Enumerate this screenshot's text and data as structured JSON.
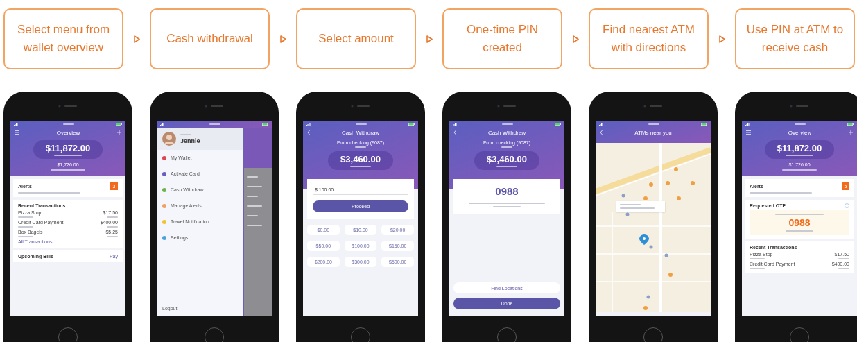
{
  "steps": [
    {
      "label": "Select menu from wallet overview",
      "screen": {
        "kind": "overview",
        "title": "Overview",
        "balance": "$11,872.00",
        "spent": "$1,726.00",
        "alerts": {
          "title": "Alerts",
          "count": "3"
        },
        "transactions": {
          "title": "Recent Transactions",
          "rows": [
            {
              "name": "Pizza Stop",
              "amount": "$17.50"
            },
            {
              "name": "Credit Card Payment",
              "amount": "$400.00"
            },
            {
              "name": "Box Bagels",
              "amount": "$5.25"
            }
          ],
          "link": "All Transactions"
        },
        "bills": {
          "title": "Upcoming Bills",
          "action": "Pay"
        }
      }
    },
    {
      "label": "Cash withdrawal",
      "screen": {
        "kind": "menu",
        "name": "Jennie",
        "items": [
          {
            "label": "My Wallet",
            "color": "#e0464e"
          },
          {
            "label": "Activate Card",
            "color": "#6a5cc0"
          },
          {
            "label": "Cash Withdraw",
            "color": "#6cb34a"
          },
          {
            "label": "Manage Alerts",
            "color": "#f0a060"
          },
          {
            "label": "Travel Notification",
            "color": "#f2c230"
          },
          {
            "label": "Settings",
            "color": "#4aa3df"
          }
        ],
        "logout": "Logout"
      }
    },
    {
      "label": "Select amount",
      "screen": {
        "kind": "withdraw",
        "title": "Cash Withdraw",
        "source": "From checking (9087)",
        "balance": "$3,460.00",
        "amount_value": "$ 100.00",
        "proceed": "Proceed",
        "amounts": [
          "$0.00",
          "$10.00",
          "$20.00",
          "$50.00",
          "$100.00",
          "$150.00",
          "$200.00",
          "$300.00",
          "$500.00"
        ]
      }
    },
    {
      "label": "One-time PIN created",
      "screen": {
        "kind": "pin",
        "title": "Cash Withdraw",
        "source": "From checking (9087)",
        "balance": "$3,460.00",
        "pin": "0988",
        "find": "Find Locations",
        "done": "Done"
      }
    },
    {
      "label": "Find nearest ATM with directions",
      "screen": {
        "kind": "map",
        "title": "ATMs near you"
      }
    },
    {
      "label": "Use PIN at ATM to receive cash",
      "screen": {
        "kind": "overview",
        "title": "Overview",
        "balance": "$11,872.00",
        "spent": "$1,726.00",
        "alerts": {
          "title": "Alerts",
          "count": "5"
        },
        "otp": {
          "title": "Requested OTP",
          "pin": "0988"
        },
        "transactions": {
          "title": "Recent Transactions",
          "rows": [
            {
              "name": "Pizza Stop",
              "amount": "$17.50"
            },
            {
              "name": "Credit Card Payment",
              "amount": "$400.00"
            }
          ]
        }
      }
    }
  ]
}
